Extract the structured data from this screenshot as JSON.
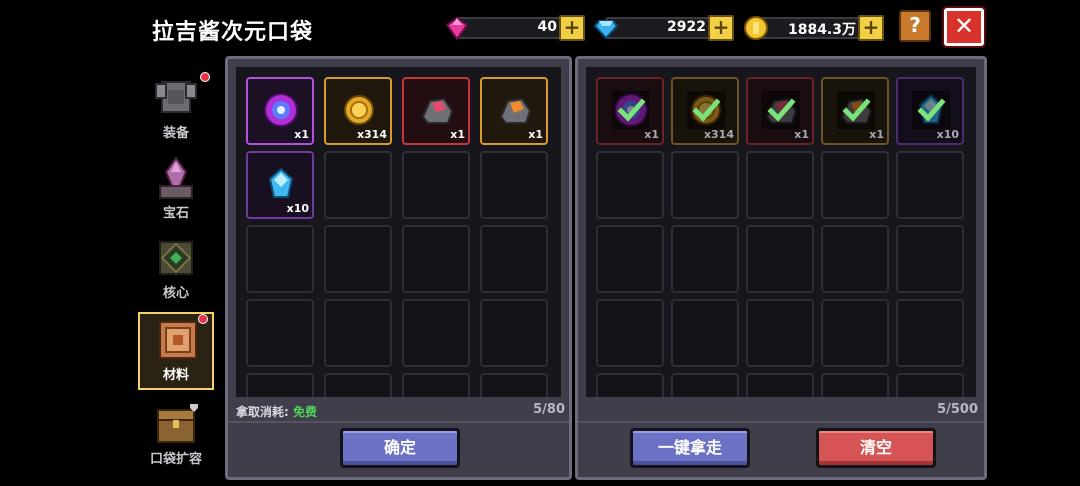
{
  "title": "拉吉酱次元口袋",
  "resources": {
    "gems": {
      "value": "40",
      "icon": "pink-gem-icon"
    },
    "diamonds": {
      "value": "2922",
      "icon": "blue-diamond-icon"
    },
    "coins": {
      "value": "1884.3万",
      "icon": "gold-coin-icon"
    }
  },
  "help_label": "?",
  "close_label": "✕",
  "sidebar": [
    {
      "label": "装备",
      "icon": "armor-icon",
      "dot": true,
      "active": false
    },
    {
      "label": "宝石",
      "icon": "gem-altar-icon",
      "dot": false,
      "active": false
    },
    {
      "label": "核心",
      "icon": "core-icon",
      "dot": false,
      "active": false
    },
    {
      "label": "材料",
      "icon": "materials-book-icon",
      "dot": true,
      "active": true
    },
    {
      "label": "口袋扩容",
      "icon": "chest-icon",
      "dot": false,
      "active": false
    }
  ],
  "left_panel": {
    "items": [
      {
        "name": "purple-orb",
        "count": "x1",
        "rarity": "purple"
      },
      {
        "name": "gold-coin",
        "count": "x314",
        "rarity": "gold"
      },
      {
        "name": "red-ore",
        "count": "x1",
        "rarity": "red"
      },
      {
        "name": "orange-ore",
        "count": "x1",
        "rarity": "gold"
      },
      {
        "name": "blue-crystal",
        "count": "x10",
        "rarity": "purple2"
      }
    ],
    "cost_label": "拿取消耗:",
    "cost_value": "免费",
    "capacity": "5/80",
    "confirm_label": "确定"
  },
  "right_panel": {
    "items": [
      {
        "name": "purple-orb",
        "count": "x1",
        "rarity": "dim-red"
      },
      {
        "name": "gold-coin",
        "count": "x314",
        "rarity": "dim-gold"
      },
      {
        "name": "red-ore",
        "count": "x1",
        "rarity": "dim-red"
      },
      {
        "name": "orange-ore",
        "count": "x1",
        "rarity": "dim-gold"
      },
      {
        "name": "blue-crystal",
        "count": "x10",
        "rarity": "dim-purple"
      }
    ],
    "capacity": "5/500",
    "take_all_label": "一键拿走",
    "clear_label": "清空"
  },
  "colors": {
    "panel": "#3f3e4a",
    "confirm": "#6b71c4",
    "clear": "#d75454",
    "free_text": "#4fd35a"
  }
}
